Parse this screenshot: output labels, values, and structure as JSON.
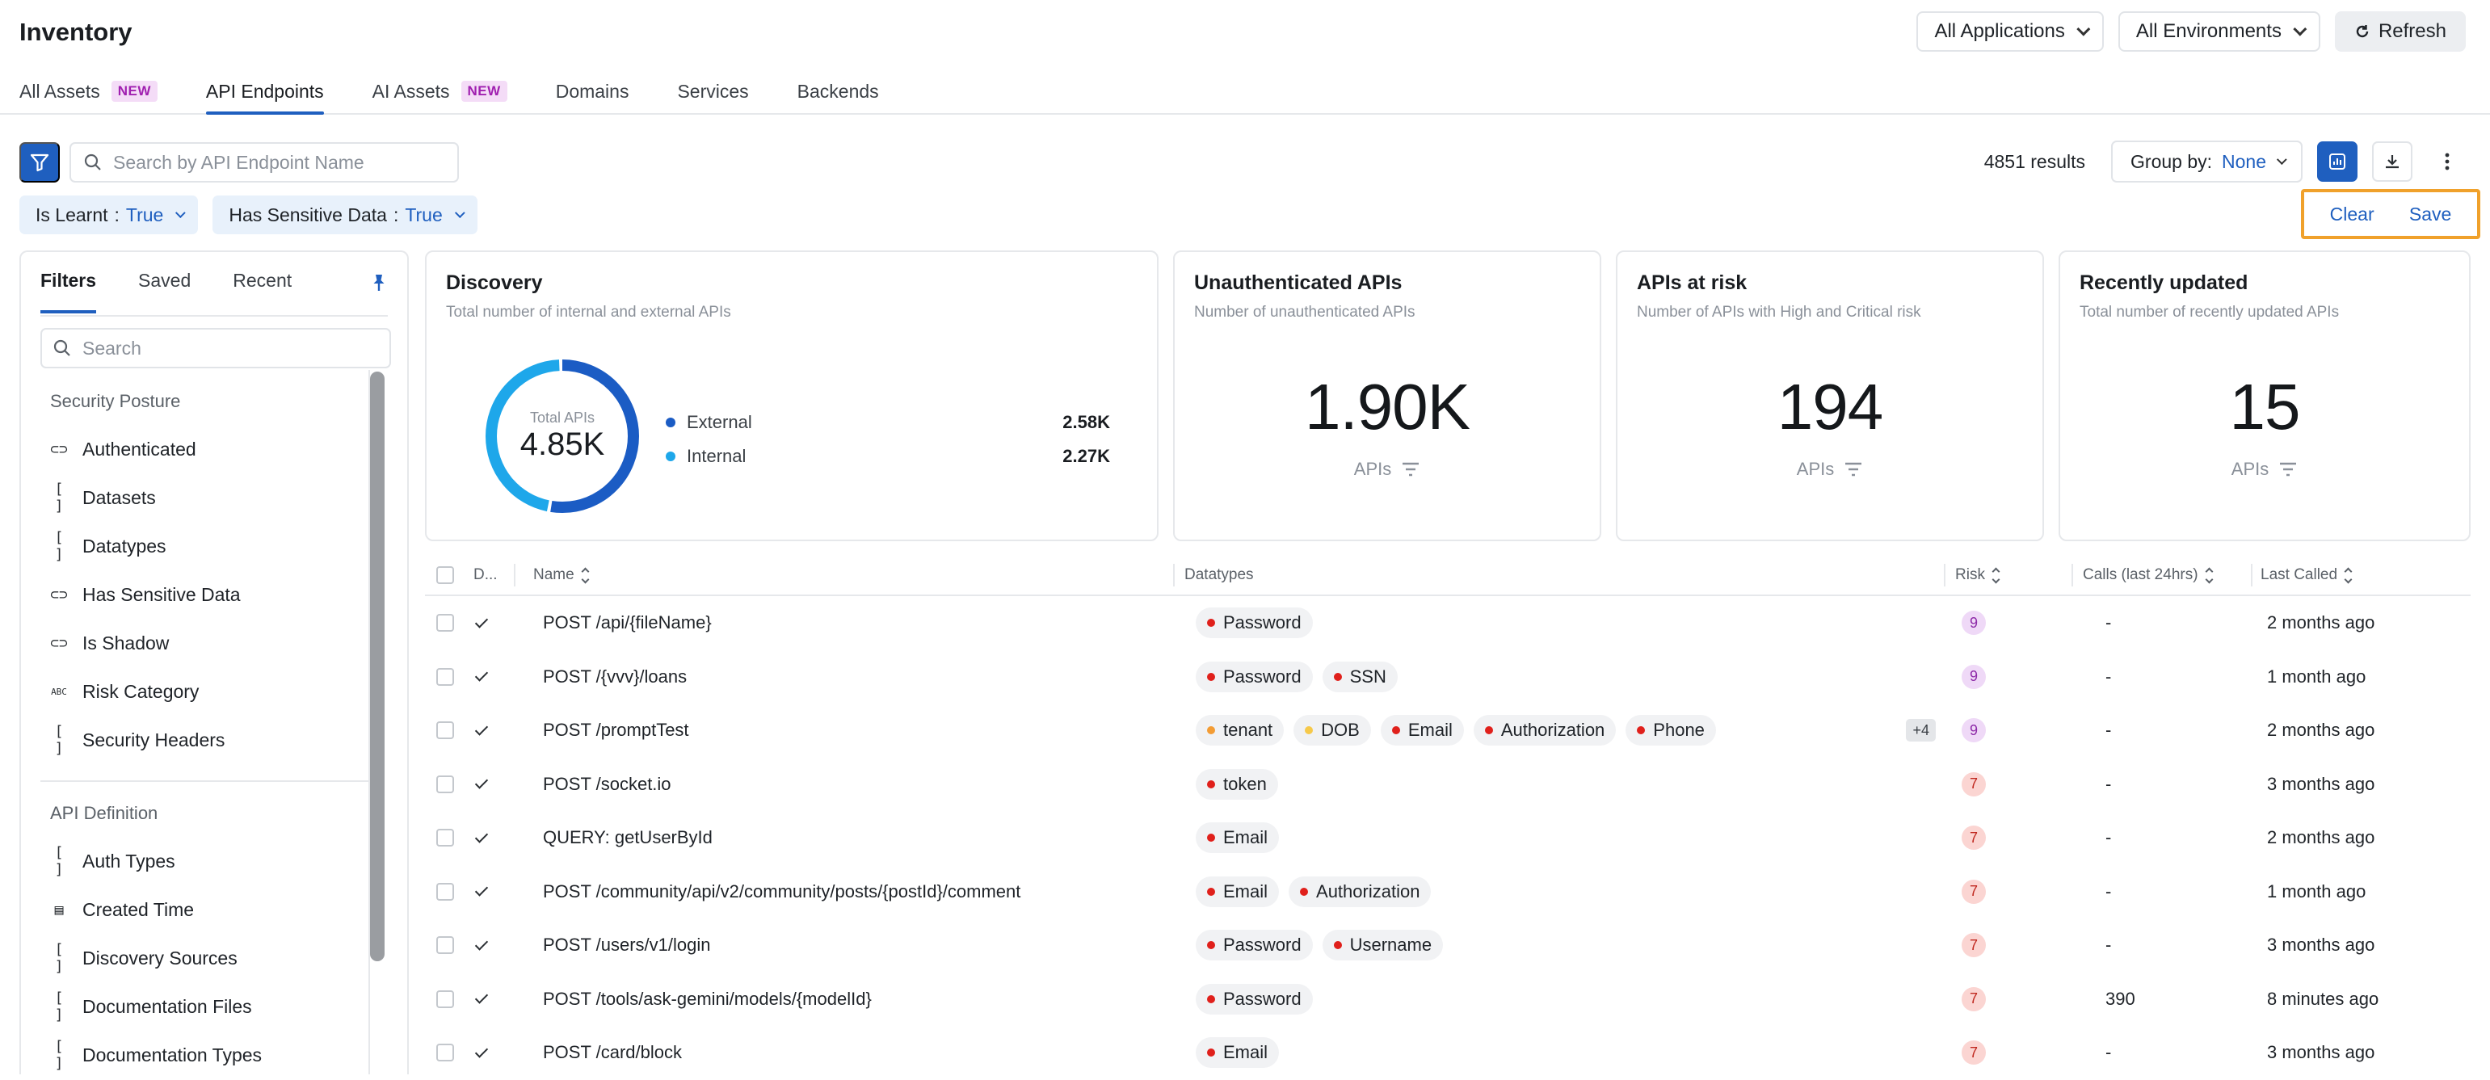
{
  "header": {
    "title": "Inventory",
    "app_filter": "All Applications",
    "env_filter": "All Environments",
    "refresh_label": "Refresh"
  },
  "tabs": [
    {
      "label": "All Assets",
      "badge": "NEW"
    },
    {
      "label": "API Endpoints",
      "badge": "",
      "active": true
    },
    {
      "label": "AI Assets",
      "badge": "NEW"
    },
    {
      "label": "Domains",
      "badge": ""
    },
    {
      "label": "Services",
      "badge": ""
    },
    {
      "label": "Backends",
      "badge": ""
    }
  ],
  "toolbar": {
    "search_placeholder": "Search by API Endpoint Name",
    "results": "4851 results",
    "group_by_label": "Group by:",
    "group_by_value": "None"
  },
  "active_filters": [
    {
      "key": "Is Learnt",
      "sep": ":",
      "value": "True"
    },
    {
      "key": "Has Sensitive Data",
      "sep": ":",
      "value": "True"
    }
  ],
  "filter_actions": {
    "clear": "Clear",
    "save": "Save"
  },
  "filters_panel": {
    "tabs": [
      "Filters",
      "Saved",
      "Recent"
    ],
    "search_placeholder": "Search",
    "sections": [
      {
        "title": "Security Posture",
        "items": [
          {
            "label": "Authenticated",
            "icon": "toggle-icon",
            "glyph": "⊂⊃"
          },
          {
            "label": "Datasets",
            "icon": "brackets-icon",
            "glyph": "[ ]"
          },
          {
            "label": "Datatypes",
            "icon": "brackets-icon",
            "glyph": "[ ]"
          },
          {
            "label": "Has Sensitive Data",
            "icon": "toggle-icon",
            "glyph": "⊂⊃"
          },
          {
            "label": "Is Shadow",
            "icon": "toggle-icon",
            "glyph": "⊂⊃"
          },
          {
            "label": "Risk Category",
            "icon": "abc-icon",
            "glyph": "ABC"
          },
          {
            "label": "Security Headers",
            "icon": "brackets-icon",
            "glyph": "[ ]"
          }
        ]
      },
      {
        "title": "API Definition",
        "items": [
          {
            "label": "Auth Types",
            "icon": "brackets-icon",
            "glyph": "[ ]"
          },
          {
            "label": "Created Time",
            "icon": "calendar-icon",
            "glyph": "▤"
          },
          {
            "label": "Discovery Sources",
            "icon": "brackets-icon",
            "glyph": "[ ]"
          },
          {
            "label": "Documentation Files",
            "icon": "brackets-icon",
            "glyph": "[ ]"
          },
          {
            "label": "Documentation Types",
            "icon": "brackets-icon",
            "glyph": "[ ]"
          }
        ]
      }
    ]
  },
  "cards": {
    "discovery": {
      "title": "Discovery",
      "subtitle": "Total number of internal and external APIs",
      "center_label": "Total APIs",
      "center_value": "4.85K",
      "legend": [
        {
          "name": "External",
          "value": "2.58K",
          "color": "#1b5cc4",
          "count": 2580
        },
        {
          "name": "Internal",
          "value": "2.27K",
          "color": "#1ea7ea",
          "count": 2270
        }
      ]
    },
    "unauth": {
      "title": "Unauthenticated APIs",
      "subtitle": "Number of unauthenticated APIs",
      "value": "1.90K",
      "unit": "APIs"
    },
    "risk": {
      "title": "APIs at risk",
      "subtitle": "Number of APIs with High and Critical risk",
      "value": "194",
      "unit": "APIs"
    },
    "recent": {
      "title": "Recently updated",
      "subtitle": "Total number of recently updated APIs",
      "value": "15",
      "unit": "APIs"
    }
  },
  "table": {
    "columns": {
      "d": "D...",
      "name": "Name",
      "datatypes": "Datatypes",
      "risk": "Risk",
      "calls": "Calls (last 24hrs)",
      "last": "Last Called"
    },
    "rows": [
      {
        "name": "POST /api/{fileName}",
        "datatypes": [
          {
            "label": "Password",
            "color": "#e0201b"
          }
        ],
        "more": "",
        "risk": "9",
        "calls": "-",
        "last": "2 months ago"
      },
      {
        "name": "POST /{vvv}/loans",
        "datatypes": [
          {
            "label": "Password",
            "color": "#e0201b"
          },
          {
            "label": "SSN",
            "color": "#e0201b"
          }
        ],
        "more": "",
        "risk": "9",
        "calls": "-",
        "last": "1 month ago"
      },
      {
        "name": "POST /promptTest",
        "datatypes": [
          {
            "label": "tenant",
            "color": "#f39c34"
          },
          {
            "label": "DOB",
            "color": "#f6c94a"
          },
          {
            "label": "Email",
            "color": "#e0201b"
          },
          {
            "label": "Authorization",
            "color": "#e0201b"
          },
          {
            "label": "Phone",
            "color": "#e0201b"
          }
        ],
        "more": "+4",
        "risk": "9",
        "calls": "-",
        "last": "2 months ago"
      },
      {
        "name": "POST /socket.io",
        "datatypes": [
          {
            "label": "token",
            "color": "#e0201b"
          }
        ],
        "more": "",
        "risk": "7",
        "calls": "-",
        "last": "3 months ago"
      },
      {
        "name": "QUERY: getUserById",
        "datatypes": [
          {
            "label": "Email",
            "color": "#e0201b"
          }
        ],
        "more": "",
        "risk": "7",
        "calls": "-",
        "last": "2 months ago"
      },
      {
        "name": "POST /community/api/v2/community/posts/{postId}/comment",
        "datatypes": [
          {
            "label": "Email",
            "color": "#e0201b"
          },
          {
            "label": "Authorization",
            "color": "#e0201b"
          }
        ],
        "more": "",
        "risk": "7",
        "calls": "-",
        "last": "1 month ago"
      },
      {
        "name": "POST /users/v1/login",
        "datatypes": [
          {
            "label": "Password",
            "color": "#e0201b"
          },
          {
            "label": "Username",
            "color": "#e0201b"
          }
        ],
        "more": "",
        "risk": "7",
        "calls": "-",
        "last": "3 months ago"
      },
      {
        "name": "POST /tools/ask-gemini/models/{modelId}",
        "datatypes": [
          {
            "label": "Password",
            "color": "#e0201b"
          }
        ],
        "more": "",
        "risk": "7",
        "calls": "390",
        "last": "8 minutes ago"
      },
      {
        "name": "POST /card/block",
        "datatypes": [
          {
            "label": "Email",
            "color": "#e0201b"
          }
        ],
        "more": "",
        "risk": "7",
        "calls": "-",
        "last": "3 months ago"
      }
    ]
  },
  "colors": {
    "accent": "#1f5fbf",
    "highlight_border": "#f0a12b",
    "risk_9_bg": "#efd9f7",
    "risk_9_fg": "#8e2aa8",
    "risk_7_bg": "#fbd5d2",
    "risk_7_fg": "#c0281f"
  }
}
